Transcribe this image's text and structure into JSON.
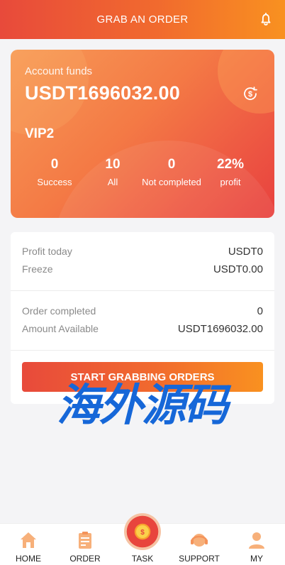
{
  "header": {
    "title": "GRAB AN ORDER",
    "bell_icon": "bell-icon"
  },
  "account": {
    "label": "Account funds",
    "value": "USDT1696032.00",
    "vip": "VIP2",
    "stats": [
      {
        "num": "0",
        "label": "Success"
      },
      {
        "num": "10",
        "label": "All"
      },
      {
        "num": "0",
        "label": "Not completed"
      },
      {
        "num": "22%",
        "label": "profit"
      }
    ]
  },
  "details": {
    "profit_today_label": "Profit today",
    "profit_today_value": "USDT0",
    "freeze_label": "Freeze",
    "freeze_value": "USDT0.00",
    "order_completed_label": "Order completed",
    "order_completed_value": "0",
    "amount_available_label": "Amount Available",
    "amount_available_value": "USDT1696032.00"
  },
  "button": {
    "label": "START GRABBING ORDERS"
  },
  "watermark": "海外源码",
  "tabs": [
    {
      "label": "HOME",
      "icon": "home-icon"
    },
    {
      "label": "ORDER",
      "icon": "order-icon"
    },
    {
      "label": "TASK",
      "icon": "task-icon"
    },
    {
      "label": "SUPPORT",
      "icon": "support-icon"
    },
    {
      "label": "MY",
      "icon": "user-icon"
    }
  ],
  "colors": {
    "accent_start": "#e84a3b",
    "accent_end": "#f99120",
    "tab_icon": "#f7b07a"
  }
}
